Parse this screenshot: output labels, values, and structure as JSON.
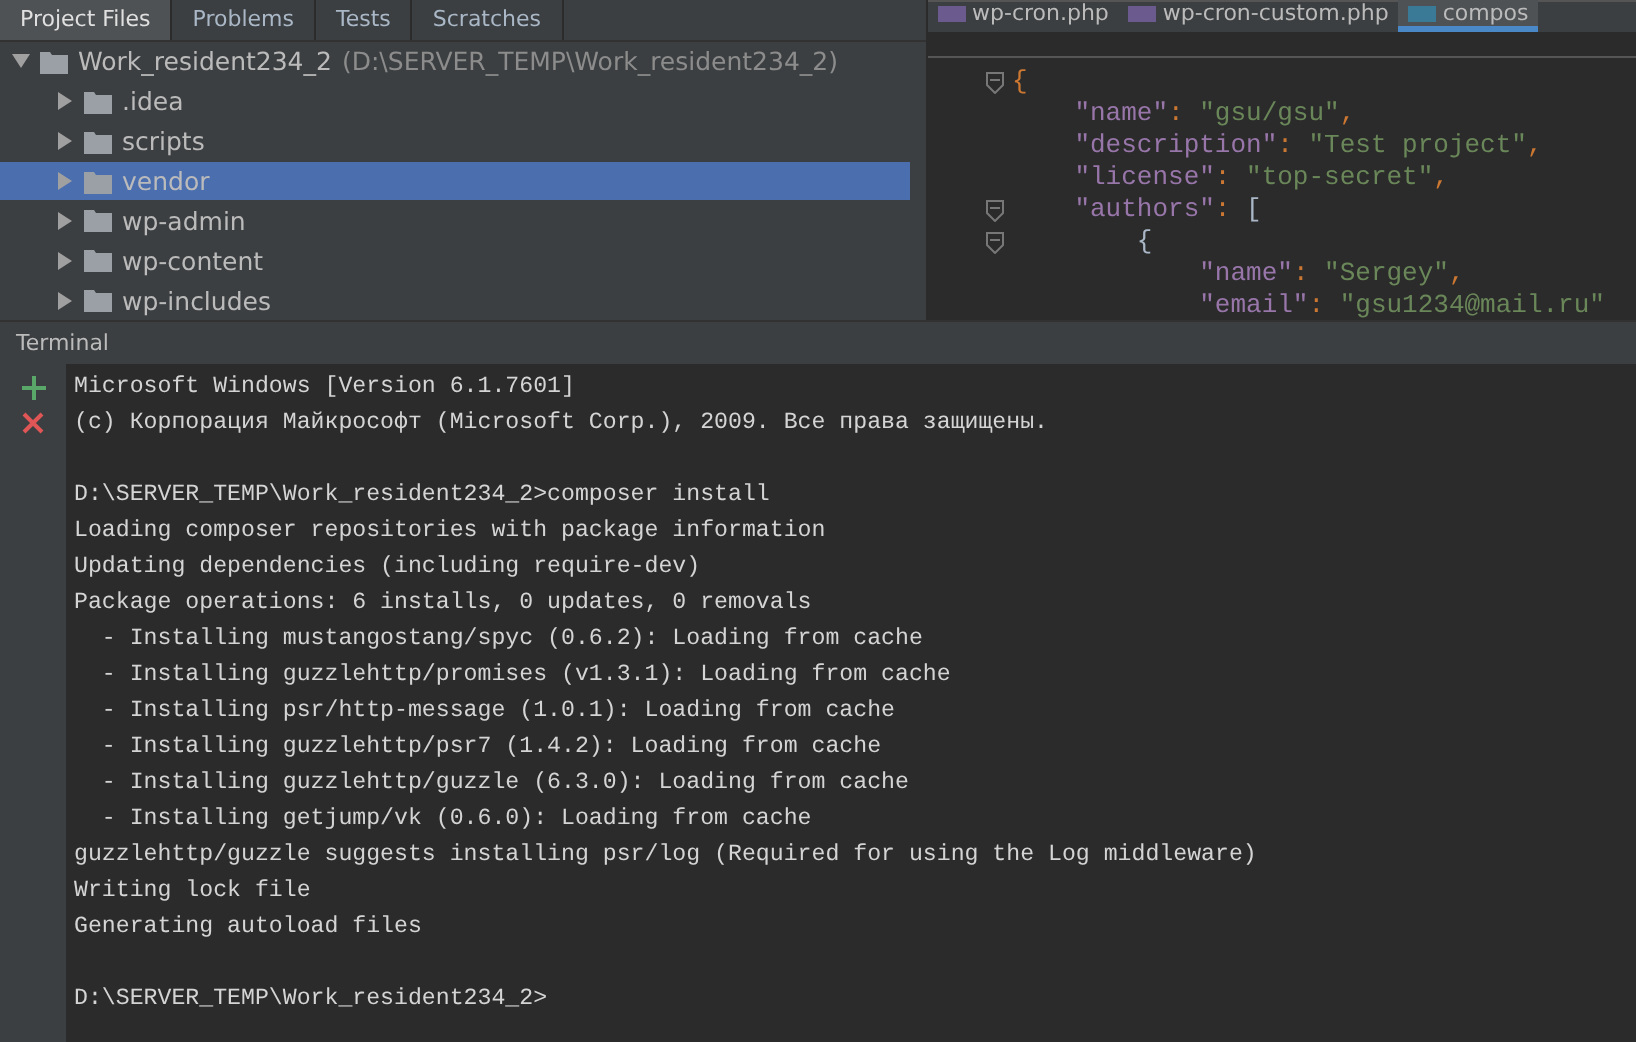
{
  "tool_tabs": [
    {
      "label": "Project Files",
      "selected": true
    },
    {
      "label": "Problems",
      "selected": false
    },
    {
      "label": "Tests",
      "selected": false
    },
    {
      "label": "Scratches",
      "selected": false
    }
  ],
  "project_tree": {
    "name": "Work_resident234_2",
    "path": "(D:\\SERVER_TEMP\\Work_resident234_2)",
    "expanded": true,
    "children": [
      {
        "name": ".idea",
        "selected": false,
        "expanded": false
      },
      {
        "name": "scripts",
        "selected": false,
        "expanded": false
      },
      {
        "name": "vendor",
        "selected": true,
        "expanded": false
      },
      {
        "name": "wp-admin",
        "selected": false,
        "expanded": false
      },
      {
        "name": "wp-content",
        "selected": false,
        "expanded": false
      },
      {
        "name": "wp-includes",
        "selected": false,
        "expanded": false
      }
    ]
  },
  "editor_tabs": [
    {
      "label": "wp-cron.php",
      "kind": "php",
      "selected": false
    },
    {
      "label": "wp-cron-custom.php",
      "kind": "php",
      "selected": false
    },
    {
      "label": "compos",
      "kind": "json",
      "selected": true
    }
  ],
  "code_lines": [
    {
      "fold": true,
      "tokens": [
        {
          "kind": "punct",
          "text": "{"
        }
      ]
    },
    {
      "fold": false,
      "tokens": [
        {
          "kind": "key",
          "text": "    \"name\""
        },
        {
          "kind": "punct",
          "text": ": "
        },
        {
          "kind": "string",
          "text": "\"gsu/gsu\""
        },
        {
          "kind": "punct",
          "text": ","
        }
      ]
    },
    {
      "fold": false,
      "tokens": [
        {
          "kind": "key",
          "text": "    \"description\""
        },
        {
          "kind": "punct",
          "text": ": "
        },
        {
          "kind": "string",
          "text": "\"Test project\""
        },
        {
          "kind": "punct",
          "text": ","
        }
      ]
    },
    {
      "fold": false,
      "tokens": [
        {
          "kind": "key",
          "text": "    \"license\""
        },
        {
          "kind": "punct",
          "text": ": "
        },
        {
          "kind": "string",
          "text": "\"top-secret\""
        },
        {
          "kind": "punct",
          "text": ","
        }
      ]
    },
    {
      "fold": true,
      "tokens": [
        {
          "kind": "key",
          "text": "    \"authors\""
        },
        {
          "kind": "punct",
          "text": ": "
        },
        {
          "kind": "bracket",
          "text": "["
        }
      ]
    },
    {
      "fold": true,
      "tokens": [
        {
          "kind": "bracket",
          "text": "        {"
        }
      ]
    },
    {
      "fold": false,
      "tokens": [
        {
          "kind": "key",
          "text": "            \"name\""
        },
        {
          "kind": "punct",
          "text": ": "
        },
        {
          "kind": "string",
          "text": "\"Sergey\""
        },
        {
          "kind": "punct",
          "text": ","
        }
      ]
    },
    {
      "fold": false,
      "tokens": [
        {
          "kind": "key",
          "text": "            \"email\""
        },
        {
          "kind": "punct",
          "text": ": "
        },
        {
          "kind": "string",
          "text": "\"gsu1234@mail.ru\""
        }
      ]
    }
  ],
  "terminal": {
    "title": "Terminal",
    "lines": [
      {
        "kind": "text",
        "text": "Microsoft Windows [Version 6.1.7601]"
      },
      {
        "kind": "text",
        "text": "(c) Корпорация Майкрософт (Microsoft Corp.), 2009. Все права защищены."
      },
      {
        "kind": "blank"
      },
      {
        "kind": "text",
        "text": "D:\\SERVER_TEMP\\Work_resident234_2>composer install"
      },
      {
        "kind": "text",
        "text": "Loading composer repositories with package information"
      },
      {
        "kind": "text",
        "text": "Updating dependencies (including require-dev)"
      },
      {
        "kind": "text",
        "text": "Package operations: 6 installs, 0 updates, 0 removals"
      },
      {
        "kind": "text",
        "text": "  - Installing mustangostang/spyc (0.6.2): Loading from cache"
      },
      {
        "kind": "text",
        "text": "  - Installing guzzlehttp/promises (v1.3.1): Loading from cache"
      },
      {
        "kind": "text",
        "text": "  - Installing psr/http-message (1.0.1): Loading from cache"
      },
      {
        "kind": "text",
        "text": "  - Installing guzzlehttp/psr7 (1.4.2): Loading from cache"
      },
      {
        "kind": "text",
        "text": "  - Installing guzzlehttp/guzzle (6.3.0): Loading from cache"
      },
      {
        "kind": "text",
        "text": "  - Installing getjump/vk (0.6.0): Loading from cache"
      },
      {
        "kind": "text",
        "text": "guzzlehttp/guzzle suggests installing psr/log (Required for using the Log middleware)"
      },
      {
        "kind": "text",
        "text": "Writing lock file"
      },
      {
        "kind": "text",
        "text": "Generating autoload files"
      },
      {
        "kind": "blank"
      },
      {
        "kind": "text",
        "text": "D:\\SERVER_TEMP\\Work_resident234_2>"
      }
    ]
  }
}
